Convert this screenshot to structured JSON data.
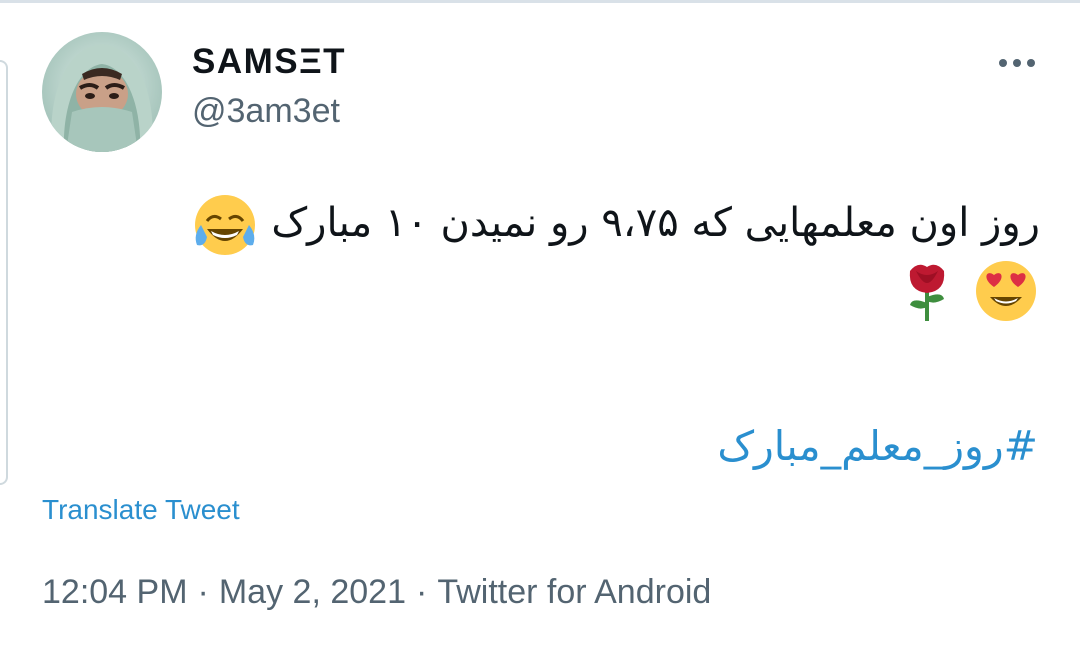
{
  "tweet": {
    "author": {
      "display_name": "SAMSΞT",
      "handle": "@3am3et"
    },
    "more_icon": "more-horizontal-icon",
    "text_line": "روز اون معلمهایی که ۹،۷۵ رو نمیدن ۱۰ مبارک",
    "emojis": [
      "face-with-tears-of-joy-icon",
      "smiling-face-with-heart-eyes-icon",
      "rose-icon"
    ],
    "hashtag": "#روز_معلم_مبارک",
    "translate_label": "Translate Tweet",
    "time": "12:04 PM",
    "separator": "·",
    "date": "May 2, 2021",
    "source": "Twitter for Android"
  },
  "colors": {
    "link": "#2a8fcf",
    "secondary_text": "#536471",
    "primary_text": "#0f1419"
  }
}
